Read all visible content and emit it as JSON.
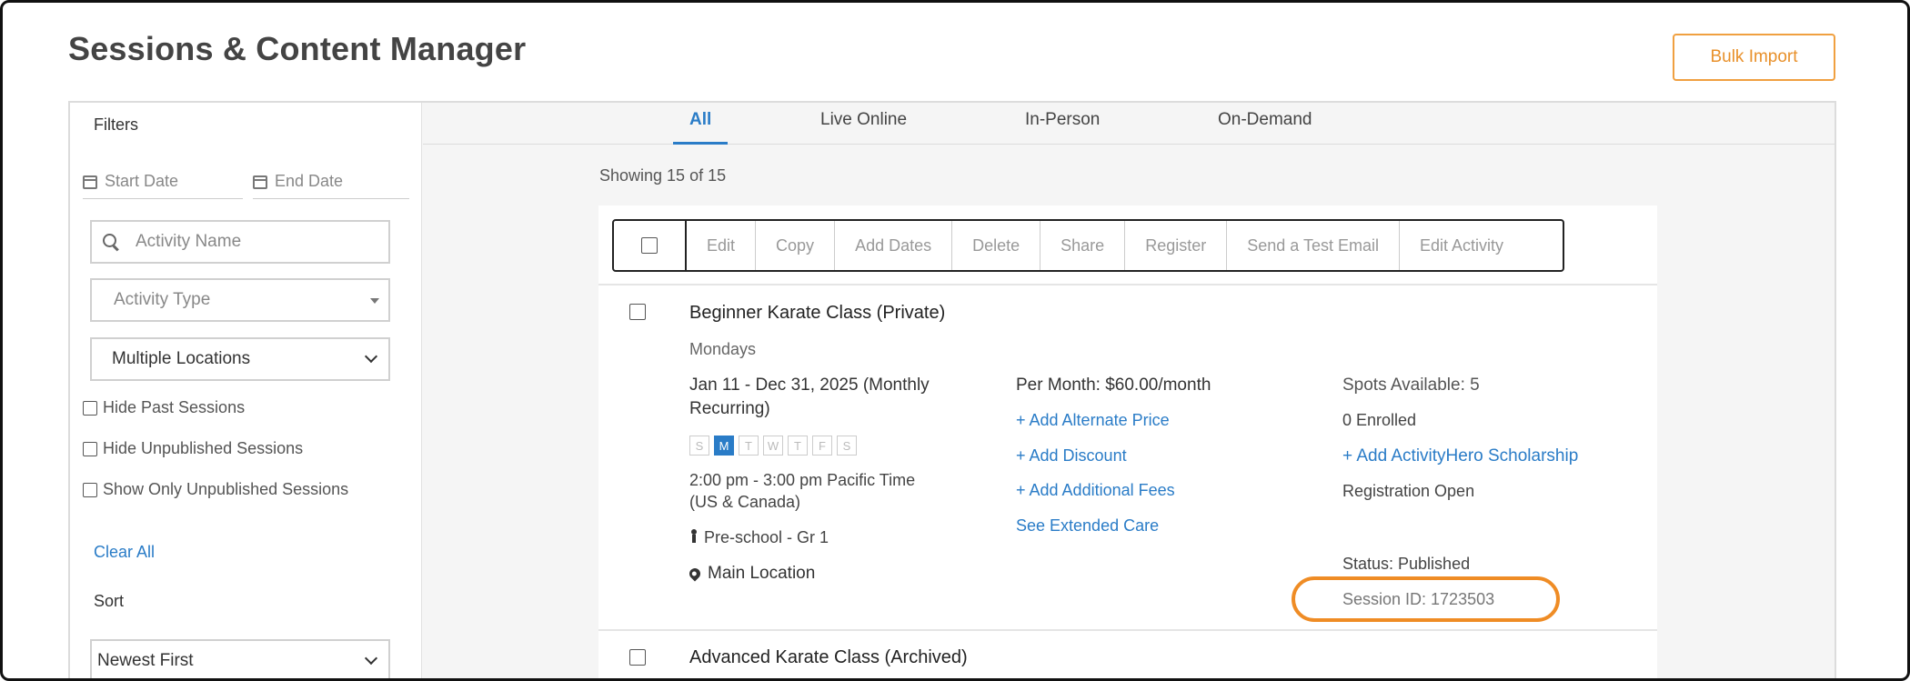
{
  "page": {
    "title": "Sessions & Content Manager",
    "bulk_import": "Bulk Import"
  },
  "filters": {
    "title": "Filters",
    "start_date": "Start Date",
    "end_date": "End Date",
    "activity_name_placeholder": "Activity Name",
    "activity_type_placeholder": "Activity Type",
    "locations": "Multiple Locations",
    "hide_past": "Hide Past Sessions",
    "hide_unpublished": "Hide Unpublished Sessions",
    "show_only_unpublished": "Show Only Unpublished Sessions",
    "clear_all": "Clear All",
    "sort_title": "Sort",
    "sort_value": "Newest First"
  },
  "tabs": [
    {
      "label": "All",
      "active": true
    },
    {
      "label": "Live Online",
      "active": false
    },
    {
      "label": "In-Person",
      "active": false
    },
    {
      "label": "On-Demand",
      "active": false
    }
  ],
  "showing": "Showing 15 of 15",
  "toolbar": {
    "buttons": [
      "Edit",
      "Copy",
      "Add Dates",
      "Delete",
      "Share",
      "Register",
      "Send a Test Email",
      "Edit Activity"
    ]
  },
  "sessions": [
    {
      "title": "Beginner Karate Class (Private)",
      "day_label": "Mondays",
      "dates": "Jan 11 - Dec 31, 2025 (Monthly Recurring)",
      "dates_line1": "Jan 11 - Dec 31, 2025 (Monthly",
      "dates_line2": "Recurring)",
      "days": [
        "S",
        "M",
        "T",
        "W",
        "T",
        "F",
        "S"
      ],
      "time_line1": "2:00 pm - 3:00 pm Pacific Time",
      "time_line2": "(US & Canada)",
      "grades": "Pre-school - Gr 1",
      "location": "Main Location",
      "price": "Per Month: $60.00/month",
      "add_alt_price": "+ Add Alternate Price",
      "add_discount": "+ Add Discount",
      "add_fees": "+ Add Additional Fees",
      "extended_care": "See Extended Care",
      "spots": "Spots Available: 5",
      "enrolled": "0 Enrolled",
      "scholarship": "+ Add ActivityHero Scholarship",
      "registration": "Registration Open",
      "status": "Status: Published",
      "session_id": "Session ID: 1723503"
    },
    {
      "title": "Advanced Karate Class (Archived)"
    }
  ],
  "colors": {
    "accent_blue": "#2a7cc7",
    "highlight_orange": "#ef8c25"
  }
}
